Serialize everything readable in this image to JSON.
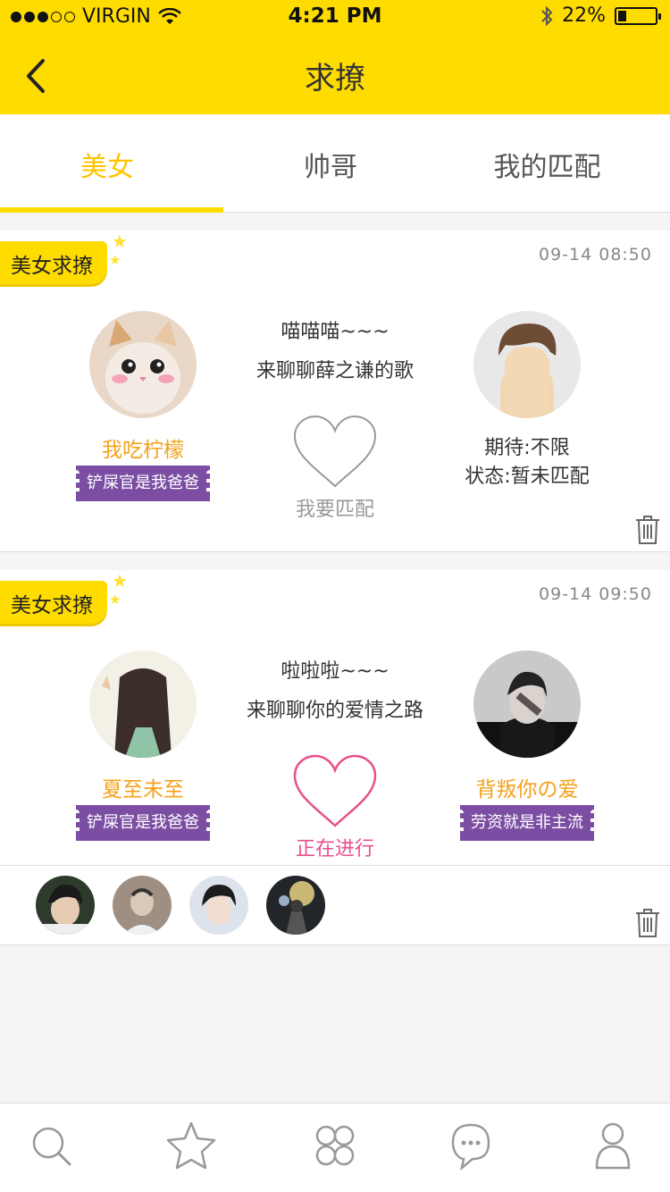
{
  "status_bar": {
    "carrier": "VIRGIN",
    "time": "4:21 PM",
    "battery": "22%",
    "battery_level": 0.22
  },
  "nav": {
    "title": "求撩"
  },
  "tabs": [
    {
      "label": "美女"
    },
    {
      "label": "帅哥"
    },
    {
      "label": "我的匹配"
    }
  ],
  "cards": [
    {
      "ribbon": "美女求撩",
      "date": "09-14 08:50",
      "left_name": "我吃柠檬",
      "left_tag": "铲屎官是我爸爸",
      "msg_line1": "喵喵喵~~~",
      "msg_line2": "来聊聊薛之谦的歌",
      "heart_label": "我要匹配",
      "right_line1": "期待:不限",
      "right_line2": "状态:暂未匹配"
    },
    {
      "ribbon": "美女求撩",
      "date": "09-14 09:50",
      "left_name": "夏至未至",
      "left_tag": "铲屎官是我爸爸",
      "msg_line1": "啦啦啦~~~",
      "msg_line2": "来聊聊你的爱情之路",
      "heart_label": "正在进行",
      "right_name": "背叛你の爱",
      "right_tag": "劳资就是非主流"
    }
  ],
  "colors": {
    "accent": "#ffdc00",
    "name": "#f4a21c",
    "tag": "#7b4ea3",
    "heart_active": "#e8508d",
    "heart_idle": "#999999"
  },
  "bottom_nav": [
    {
      "icon": "search-icon"
    },
    {
      "icon": "star-icon"
    },
    {
      "icon": "grid-icon"
    },
    {
      "icon": "chat-icon"
    },
    {
      "icon": "profile-icon"
    }
  ]
}
